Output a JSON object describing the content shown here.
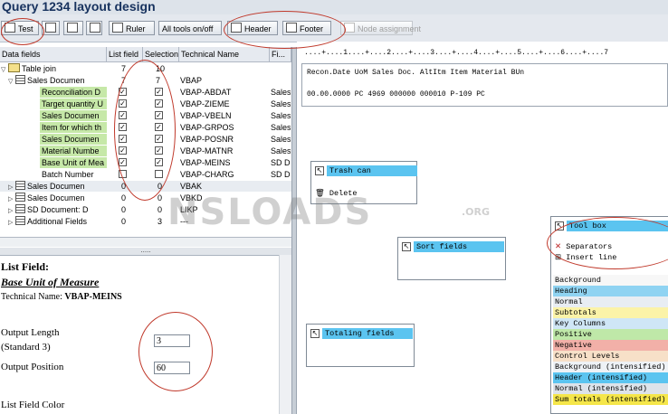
{
  "title": "Query 1234 layout design",
  "toolbar": {
    "test": "Test",
    "ruler": "Ruler",
    "all_tools": "All tools on/off",
    "header": "Header",
    "footer": "Footer",
    "node_assignment": "Node assignment"
  },
  "tree": {
    "headers": [
      "Data fields",
      "List field",
      "Selection",
      "Technical Name",
      "Fi..."
    ],
    "rows": [
      {
        "name": "Table join",
        "list": "7",
        "sel": "10",
        "tech": "",
        "fi": ""
      },
      {
        "name": "Sales Documen",
        "list": "7",
        "sel": "7",
        "tech": "VBAP",
        "fi": ""
      },
      {
        "name": "Reconciliation D",
        "tech": "VBAP-ABDAT",
        "fi": "Sales"
      },
      {
        "name": "Target quantity U",
        "tech": "VBAP-ZIEME",
        "fi": "Sales"
      },
      {
        "name": "Sales Documen",
        "tech": "VBAP-VBELN",
        "fi": "Sales"
      },
      {
        "name": "Item for which th",
        "tech": "VBAP-GRPOS",
        "fi": "Sales"
      },
      {
        "name": "Sales Documen",
        "tech": "VBAP-POSNR",
        "fi": "Sales"
      },
      {
        "name": "Material Numbe",
        "tech": "VBAP-MATNR",
        "fi": "Sales"
      },
      {
        "name": "Base Unit of Mea",
        "tech": "VBAP-MEINS",
        "fi": "SD D"
      },
      {
        "name": "Batch Number",
        "tech": "VBAP-CHARG",
        "fi": "SD D"
      },
      {
        "name": "Sales Documen",
        "list": "0",
        "sel": "0",
        "tech": "VBAK",
        "fi": ""
      },
      {
        "name": "Sales Documen",
        "list": "0",
        "sel": "0",
        "tech": "VBKD",
        "fi": ""
      },
      {
        "name": "SD Document: D",
        "list": "0",
        "sel": "0",
        "tech": "LIKP",
        "fi": ""
      },
      {
        "name": "Additional Fields",
        "list": "0",
        "sel": "3",
        "tech": "---",
        "fi": ""
      }
    ]
  },
  "detail": {
    "heading": "List Field:",
    "field_name": "Base Unit of Measure",
    "tech_label": "Technical Name:",
    "tech_value": "VBAP-MEINS",
    "output_length_label": "Output Length",
    "standard_label": "(Standard 3)",
    "output_length_value": "3",
    "output_position_label": "Output Position",
    "output_position_value": "60",
    "color_label": "List Field Color"
  },
  "layout": {
    "ruler": "....+....1....+....2....+....3....+....4....+....5....+....6....+....7",
    "header_line": "Recon.Date UoM Sales Doc. AltItm Item   Material            BUn",
    "data_line": "00.00.0000 PC  4969       000000 000010 P-109               PC"
  },
  "trash": {
    "title": "Trash can",
    "delete": "Delete"
  },
  "sort": {
    "title": "Sort fields"
  },
  "totaling": {
    "title": "Totaling fields"
  },
  "toolbox": {
    "title": "Tool box",
    "separators": "Separators",
    "insert_line": "Insert line",
    "colors": [
      {
        "label": "Background",
        "color": "#f7f7f7"
      },
      {
        "label": "Heading",
        "color": "#8fd3f2"
      },
      {
        "label": "Normal",
        "color": "#e8edf3"
      },
      {
        "label": "Subtotals",
        "color": "#fbf3a8"
      },
      {
        "label": "Key Columns",
        "color": "#cfe6f6"
      },
      {
        "label": "Positive",
        "color": "#bfe8a8"
      },
      {
        "label": "Negative",
        "color": "#f2b0a8"
      },
      {
        "label": "Control Levels",
        "color": "#f7e0c8"
      },
      {
        "label": "Background (intensified)",
        "color": "#eef2f6"
      },
      {
        "label": "Header (intensified)",
        "color": "#5bc4f0"
      },
      {
        "label": "Normal (intensified)",
        "color": "#dde3ea"
      },
      {
        "label": "Sum totals (intensified)",
        "color": "#f5e64a"
      }
    ]
  },
  "watermark": {
    "text": "NSLOADS",
    "suffix": ".ORG"
  }
}
